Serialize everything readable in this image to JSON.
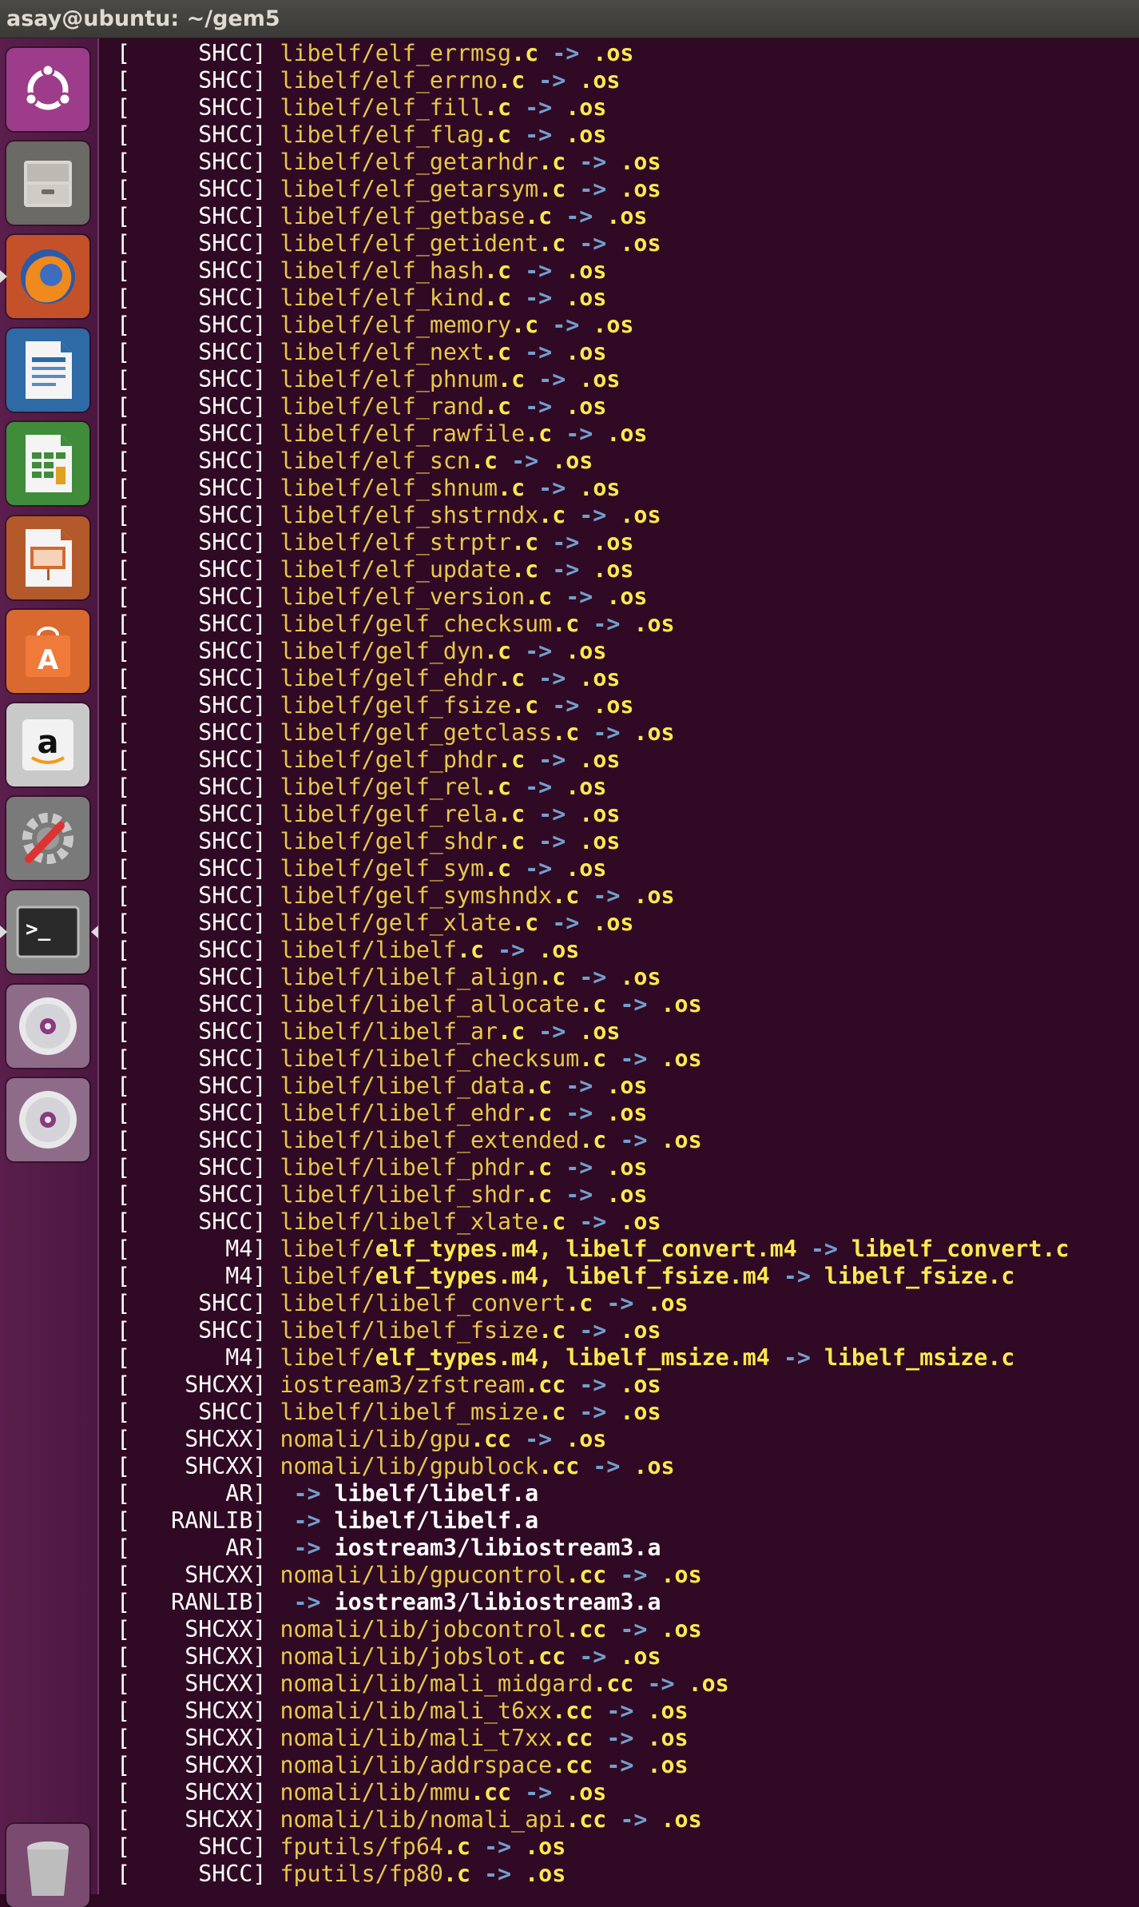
{
  "window": {
    "title": "asay@ubuntu: ~/gem5"
  },
  "launcher": {
    "items": [
      {
        "name": "ubuntu-dash-icon",
        "bg": "#9d3c8a"
      },
      {
        "name": "files-icon",
        "bg": "#6b6a64"
      },
      {
        "name": "firefox-icon",
        "bg": "#c5512a"
      },
      {
        "name": "libreoffice-writer-icon",
        "bg": "#2d6aa6"
      },
      {
        "name": "libreoffice-calc-icon",
        "bg": "#3f8c3b"
      },
      {
        "name": "libreoffice-impress-icon",
        "bg": "#b45a2a"
      },
      {
        "name": "software-center-icon",
        "bg": "#d9692e"
      },
      {
        "name": "amazon-icon",
        "bg": "#c9c9c9"
      },
      {
        "name": "system-settings-icon",
        "bg": "#7a7a7a"
      },
      {
        "name": "terminal-icon",
        "bg": "#8a8a8a"
      },
      {
        "name": "dvd-drive-icon",
        "bg": "#8e6b89"
      },
      {
        "name": "dvd-drive-icon-2",
        "bg": "#8e6b89"
      },
      {
        "name": "trash-icon",
        "bg": "#7a4a70"
      }
    ]
  },
  "terminal": {
    "lines": [
      {
        "tool": "SHCC",
        "dir": "libelf/",
        "name": "elf_errmsg",
        "ext": ".c",
        "arrow": "->",
        "dst": ".os"
      },
      {
        "tool": "SHCC",
        "dir": "libelf/",
        "name": "elf_errno",
        "ext": ".c",
        "arrow": "->",
        "dst": ".os"
      },
      {
        "tool": "SHCC",
        "dir": "libelf/",
        "name": "elf_fill",
        "ext": ".c",
        "arrow": "->",
        "dst": ".os"
      },
      {
        "tool": "SHCC",
        "dir": "libelf/",
        "name": "elf_flag",
        "ext": ".c",
        "arrow": "->",
        "dst": ".os"
      },
      {
        "tool": "SHCC",
        "dir": "libelf/",
        "name": "elf_getarhdr",
        "ext": ".c",
        "arrow": "->",
        "dst": ".os"
      },
      {
        "tool": "SHCC",
        "dir": "libelf/",
        "name": "elf_getarsym",
        "ext": ".c",
        "arrow": "->",
        "dst": ".os"
      },
      {
        "tool": "SHCC",
        "dir": "libelf/",
        "name": "elf_getbase",
        "ext": ".c",
        "arrow": "->",
        "dst": ".os"
      },
      {
        "tool": "SHCC",
        "dir": "libelf/",
        "name": "elf_getident",
        "ext": ".c",
        "arrow": "->",
        "dst": ".os"
      },
      {
        "tool": "SHCC",
        "dir": "libelf/",
        "name": "elf_hash",
        "ext": ".c",
        "arrow": "->",
        "dst": ".os"
      },
      {
        "tool": "SHCC",
        "dir": "libelf/",
        "name": "elf_kind",
        "ext": ".c",
        "arrow": "->",
        "dst": ".os"
      },
      {
        "tool": "SHCC",
        "dir": "libelf/",
        "name": "elf_memory",
        "ext": ".c",
        "arrow": "->",
        "dst": ".os"
      },
      {
        "tool": "SHCC",
        "dir": "libelf/",
        "name": "elf_next",
        "ext": ".c",
        "arrow": "->",
        "dst": ".os"
      },
      {
        "tool": "SHCC",
        "dir": "libelf/",
        "name": "elf_phnum",
        "ext": ".c",
        "arrow": "->",
        "dst": ".os"
      },
      {
        "tool": "SHCC",
        "dir": "libelf/",
        "name": "elf_rand",
        "ext": ".c",
        "arrow": "->",
        "dst": ".os"
      },
      {
        "tool": "SHCC",
        "dir": "libelf/",
        "name": "elf_rawfile",
        "ext": ".c",
        "arrow": "->",
        "dst": ".os"
      },
      {
        "tool": "SHCC",
        "dir": "libelf/",
        "name": "elf_scn",
        "ext": ".c",
        "arrow": "->",
        "dst": ".os"
      },
      {
        "tool": "SHCC",
        "dir": "libelf/",
        "name": "elf_shnum",
        "ext": ".c",
        "arrow": "->",
        "dst": ".os"
      },
      {
        "tool": "SHCC",
        "dir": "libelf/",
        "name": "elf_shstrndx",
        "ext": ".c",
        "arrow": "->",
        "dst": ".os"
      },
      {
        "tool": "SHCC",
        "dir": "libelf/",
        "name": "elf_strptr",
        "ext": ".c",
        "arrow": "->",
        "dst": ".os"
      },
      {
        "tool": "SHCC",
        "dir": "libelf/",
        "name": "elf_update",
        "ext": ".c",
        "arrow": "->",
        "dst": ".os"
      },
      {
        "tool": "SHCC",
        "dir": "libelf/",
        "name": "elf_version",
        "ext": ".c",
        "arrow": "->",
        "dst": ".os"
      },
      {
        "tool": "SHCC",
        "dir": "libelf/",
        "name": "gelf_checksum",
        "ext": ".c",
        "arrow": "->",
        "dst": ".os"
      },
      {
        "tool": "SHCC",
        "dir": "libelf/",
        "name": "gelf_dyn",
        "ext": ".c",
        "arrow": "->",
        "dst": ".os"
      },
      {
        "tool": "SHCC",
        "dir": "libelf/",
        "name": "gelf_ehdr",
        "ext": ".c",
        "arrow": "->",
        "dst": ".os"
      },
      {
        "tool": "SHCC",
        "dir": "libelf/",
        "name": "gelf_fsize",
        "ext": ".c",
        "arrow": "->",
        "dst": ".os"
      },
      {
        "tool": "SHCC",
        "dir": "libelf/",
        "name": "gelf_getclass",
        "ext": ".c",
        "arrow": "->",
        "dst": ".os"
      },
      {
        "tool": "SHCC",
        "dir": "libelf/",
        "name": "gelf_phdr",
        "ext": ".c",
        "arrow": "->",
        "dst": ".os"
      },
      {
        "tool": "SHCC",
        "dir": "libelf/",
        "name": "gelf_rel",
        "ext": ".c",
        "arrow": "->",
        "dst": ".os"
      },
      {
        "tool": "SHCC",
        "dir": "libelf/",
        "name": "gelf_rela",
        "ext": ".c",
        "arrow": "->",
        "dst": ".os"
      },
      {
        "tool": "SHCC",
        "dir": "libelf/",
        "name": "gelf_shdr",
        "ext": ".c",
        "arrow": "->",
        "dst": ".os"
      },
      {
        "tool": "SHCC",
        "dir": "libelf/",
        "name": "gelf_sym",
        "ext": ".c",
        "arrow": "->",
        "dst": ".os"
      },
      {
        "tool": "SHCC",
        "dir": "libelf/",
        "name": "gelf_symshndx",
        "ext": ".c",
        "arrow": "->",
        "dst": ".os"
      },
      {
        "tool": "SHCC",
        "dir": "libelf/",
        "name": "gelf_xlate",
        "ext": ".c",
        "arrow": "->",
        "dst": ".os"
      },
      {
        "tool": "SHCC",
        "dir": "libelf/",
        "name": "libelf",
        "ext": ".c",
        "arrow": "->",
        "dst": ".os"
      },
      {
        "tool": "SHCC",
        "dir": "libelf/",
        "name": "libelf_align",
        "ext": ".c",
        "arrow": "->",
        "dst": ".os"
      },
      {
        "tool": "SHCC",
        "dir": "libelf/",
        "name": "libelf_allocate",
        "ext": ".c",
        "arrow": "->",
        "dst": ".os"
      },
      {
        "tool": "SHCC",
        "dir": "libelf/",
        "name": "libelf_ar",
        "ext": ".c",
        "arrow": "->",
        "dst": ".os"
      },
      {
        "tool": "SHCC",
        "dir": "libelf/",
        "name": "libelf_checksum",
        "ext": ".c",
        "arrow": "->",
        "dst": ".os"
      },
      {
        "tool": "SHCC",
        "dir": "libelf/",
        "name": "libelf_data",
        "ext": ".c",
        "arrow": "->",
        "dst": ".os"
      },
      {
        "tool": "SHCC",
        "dir": "libelf/",
        "name": "libelf_ehdr",
        "ext": ".c",
        "arrow": "->",
        "dst": ".os"
      },
      {
        "tool": "SHCC",
        "dir": "libelf/",
        "name": "libelf_extended",
        "ext": ".c",
        "arrow": "->",
        "dst": ".os"
      },
      {
        "tool": "SHCC",
        "dir": "libelf/",
        "name": "libelf_phdr",
        "ext": ".c",
        "arrow": "->",
        "dst": ".os"
      },
      {
        "tool": "SHCC",
        "dir": "libelf/",
        "name": "libelf_shdr",
        "ext": ".c",
        "arrow": "->",
        "dst": ".os"
      },
      {
        "tool": "SHCC",
        "dir": "libelf/",
        "name": "libelf_xlate",
        "ext": ".c",
        "arrow": "->",
        "dst": ".os"
      },
      {
        "tool": "M4",
        "dir": "libelf/",
        "m4": "elf_types.m4, libelf_convert.m4",
        "arrow": "->",
        "out": "libelf_convert.c"
      },
      {
        "tool": "M4",
        "dir": "libelf/",
        "m4": "elf_types.m4, libelf_fsize.m4",
        "arrow": "->",
        "out": "libelf_fsize.c"
      },
      {
        "tool": "SHCC",
        "dir": "libelf/",
        "name": "libelf_convert",
        "ext": ".c",
        "arrow": "->",
        "dst": ".os"
      },
      {
        "tool": "SHCC",
        "dir": "libelf/",
        "name": "libelf_fsize",
        "ext": ".c",
        "arrow": "->",
        "dst": ".os"
      },
      {
        "tool": "M4",
        "dir": "libelf/",
        "m4": "elf_types.m4, libelf_msize.m4",
        "arrow": "->",
        "out": "libelf_msize.c"
      },
      {
        "tool": "SHCXX",
        "dir": "iostream3/",
        "name": "zfstream",
        "ext": ".cc",
        "arrow": "->",
        "dst": ".os"
      },
      {
        "tool": "SHCC",
        "dir": "libelf/",
        "name": "libelf_msize",
        "ext": ".c",
        "arrow": "->",
        "dst": ".os"
      },
      {
        "tool": "SHCXX",
        "dir": "nomali/lib/",
        "name": "gpu",
        "ext": ".cc",
        "arrow": "->",
        "dst": ".os"
      },
      {
        "tool": "SHCXX",
        "dir": "nomali/lib/",
        "name": "gpublock",
        "ext": ".cc",
        "arrow": "->",
        "dst": ".os"
      },
      {
        "tool": "AR",
        "arrow": "->",
        "lib": "libelf/libelf.a"
      },
      {
        "tool": "RANLIB",
        "arrow": "->",
        "lib": "libelf/libelf.a"
      },
      {
        "tool": "AR",
        "arrow": "->",
        "lib": "iostream3/libiostream3.a"
      },
      {
        "tool": "SHCXX",
        "dir": "nomali/lib/",
        "name": "gpucontrol",
        "ext": ".cc",
        "arrow": "->",
        "dst": ".os"
      },
      {
        "tool": "RANLIB",
        "arrow": "->",
        "lib": "iostream3/libiostream3.a"
      },
      {
        "tool": "SHCXX",
        "dir": "nomali/lib/",
        "name": "jobcontrol",
        "ext": ".cc",
        "arrow": "->",
        "dst": ".os"
      },
      {
        "tool": "SHCXX",
        "dir": "nomali/lib/",
        "name": "jobslot",
        "ext": ".cc",
        "arrow": "->",
        "dst": ".os"
      },
      {
        "tool": "SHCXX",
        "dir": "nomali/lib/",
        "name": "mali_midgard",
        "ext": ".cc",
        "arrow": "->",
        "dst": ".os"
      },
      {
        "tool": "SHCXX",
        "dir": "nomali/lib/",
        "name": "mali_t6xx",
        "ext": ".cc",
        "arrow": "->",
        "dst": ".os"
      },
      {
        "tool": "SHCXX",
        "dir": "nomali/lib/",
        "name": "mali_t7xx",
        "ext": ".cc",
        "arrow": "->",
        "dst": ".os"
      },
      {
        "tool": "SHCXX",
        "dir": "nomali/lib/",
        "name": "addrspace",
        "ext": ".cc",
        "arrow": "->",
        "dst": ".os"
      },
      {
        "tool": "SHCXX",
        "dir": "nomali/lib/",
        "name": "mmu",
        "ext": ".cc",
        "arrow": "->",
        "dst": ".os"
      },
      {
        "tool": "SHCXX",
        "dir": "nomali/lib/",
        "name": "nomali_api",
        "ext": ".cc",
        "arrow": "->",
        "dst": ".os"
      },
      {
        "tool": "SHCC",
        "dir": "fputils/",
        "name": "fp64",
        "ext": ".c",
        "arrow": "->",
        "dst": ".os"
      },
      {
        "tool": "SHCC",
        "dir": "fputils/",
        "name": "fp80",
        "ext": ".c",
        "arrow": "->",
        "dst": ".os"
      }
    ]
  }
}
